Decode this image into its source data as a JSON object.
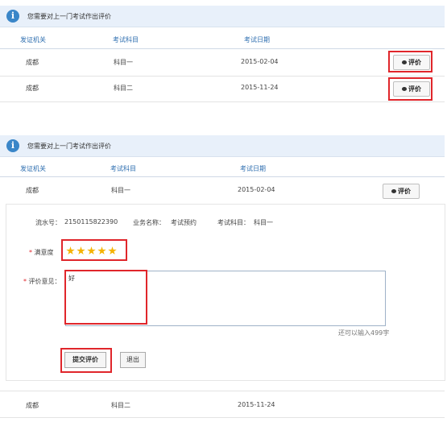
{
  "top": {
    "notice": "您需要对上一门考试作出评价",
    "headers": [
      "发证机关",
      "考试科目",
      "考试日期"
    ],
    "rows": [
      {
        "agency": "成都",
        "subject": "科目一",
        "date": "2015-02-04",
        "action": "评价"
      },
      {
        "agency": "成都",
        "subject": "科目二",
        "date": "2015-11-24",
        "action": "评价"
      }
    ]
  },
  "bottom": {
    "notice": "您需要对上一门考试作出评价",
    "headers": [
      "发证机关",
      "考试科目",
      "考试日期"
    ],
    "row1": {
      "agency": "成都",
      "subject": "科目一",
      "date": "2015-02-04",
      "action": "评价"
    },
    "detail": {
      "serial_label": "流水号：",
      "serial": "2150115822390",
      "business_label": "业务名称：",
      "business": "考试预约",
      "subject_label": "考试科目：",
      "subject": "科目一"
    },
    "form": {
      "satisfaction_label": "满意度",
      "rating": 5,
      "comment_label": "评价意见：",
      "comment_value": "好",
      "remaining": "还可以输入499字",
      "submit": "提交评价",
      "exit": "退出"
    },
    "row2": {
      "agency": "成都",
      "subject": "科目二",
      "date": "2015-11-24"
    }
  },
  "colors": {
    "highlight": "#e0262b",
    "accent": "#2f6fb0",
    "star": "#f5b300"
  }
}
